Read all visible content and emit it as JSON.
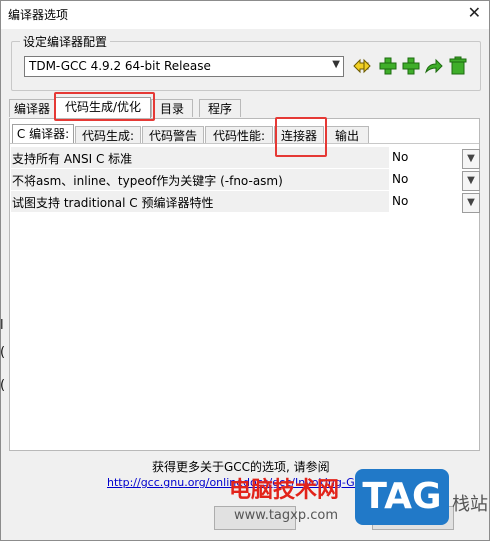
{
  "window": {
    "title": "编译器选项",
    "close_glyph": "✕"
  },
  "compiler_set": {
    "group_label": "设定编译器配置",
    "selected": "TDM-GCC 4.9.2 64-bit Release",
    "toolbar_icons": [
      "rename-icon",
      "add-icon",
      "add-copy-icon",
      "export-icon",
      "delete-icon"
    ]
  },
  "main_tabs": [
    {
      "label": "编译器",
      "active": false
    },
    {
      "label": "代码生成/优化",
      "active": true
    },
    {
      "label": "目录",
      "active": false
    },
    {
      "label": "程序",
      "active": false
    }
  ],
  "sub_tabs": [
    {
      "label": "C 编译器:",
      "active": true
    },
    {
      "label": "代码生成:",
      "active": false
    },
    {
      "label": "代码警告",
      "active": false
    },
    {
      "label": "代码性能:",
      "active": false
    },
    {
      "label": "连接器",
      "active": false
    },
    {
      "label": "输出",
      "active": false
    }
  ],
  "options": [
    {
      "label": "支持所有 ANSI C 标准",
      "value": "No"
    },
    {
      "label": "不将asm、inline、typeof作为关键字 (-fno-asm)",
      "value": "No"
    },
    {
      "label": "试图支持 traditional C 预编译器特性",
      "value": "No"
    }
  ],
  "footer": {
    "info": "获得更多关于GCC的选项, 请参阅",
    "link": "http://gcc.gnu.org/onlinedocs/gcc/Invoking-GCC.html"
  },
  "watermark": {
    "brand_cn": "电脑技术网",
    "brand_url": "www.tagxp.com",
    "tag": "TAG",
    "side": "栈站"
  },
  "colors": {
    "highlight_box": "#e53935",
    "watermark_red": "#e2231a",
    "watermark_blue": "#2179c8",
    "link": "#0000cc"
  }
}
